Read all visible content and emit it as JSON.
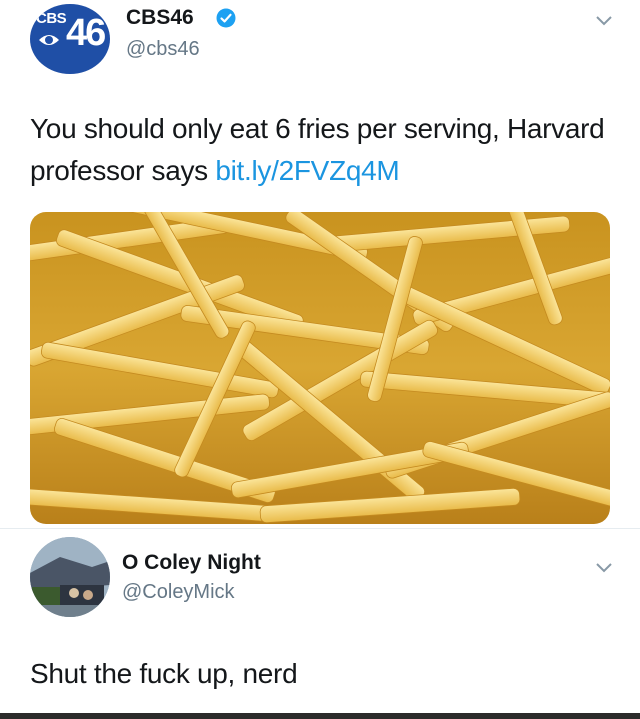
{
  "tweets": [
    {
      "display_name": "CBS46",
      "handle": "@cbs46",
      "verified": true,
      "avatar_logo": "CBS 46",
      "text": "You should only eat 6 fries per serving, Harvard professor says ",
      "link": "bit.ly/2FVZq4M",
      "media_icon": "french-fries-photo"
    },
    {
      "display_name": "O Coley Night",
      "handle": "@ColeyMick",
      "verified": false,
      "text": "Shut the fuck up, nerd"
    }
  ],
  "colors": {
    "link": "#1b95e0",
    "verified": "#1da1f2",
    "handle": "#657786",
    "cbs_blue": "#1f4fa6"
  }
}
